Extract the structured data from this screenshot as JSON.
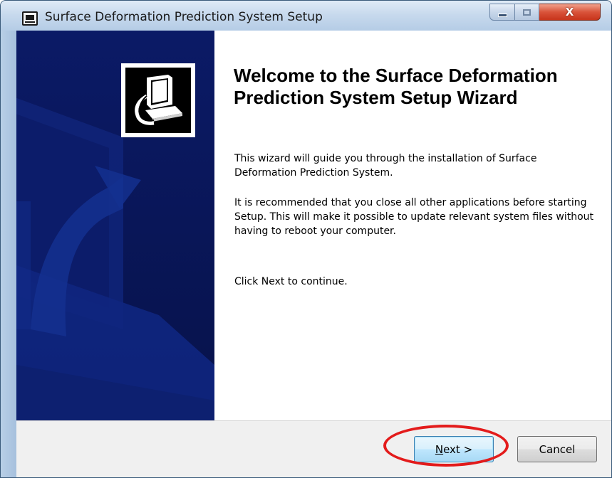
{
  "window": {
    "title": "Surface Deformation Prediction System Setup",
    "close_glyph": "X"
  },
  "heading": {
    "welcome": "Welcome to the Surface Deformation Prediction System Setup Wizard"
  },
  "body": {
    "paragraph_1": "This wizard will guide you through the installation of Surface Deformation Prediction System.",
    "paragraph_2": "It is recommended that you close all other applications before starting Setup. This will make it possible to update relevant system files without having to reboot your computer.",
    "paragraph_3": "Click Next to continue."
  },
  "footer": {
    "next_label_accel": "N",
    "next_label_rest": "ext >",
    "cancel_label": "Cancel"
  },
  "colors": {
    "banner": "#0a1860",
    "highlight_ellipse": "#e31b1b",
    "close_button": "#c7341b"
  },
  "icons": {
    "title_icon": "installer-computer-icon",
    "logo": "installer-computer-logo",
    "minimize": "minimize-icon",
    "maximize": "maximize-icon",
    "close": "close-icon"
  }
}
